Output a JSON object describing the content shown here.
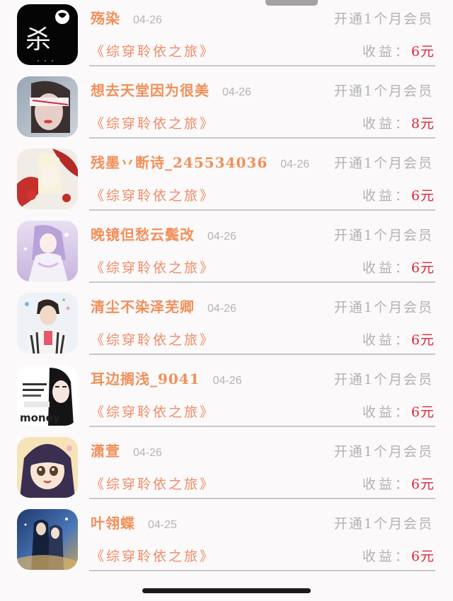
{
  "records": [
    {
      "username": "殇染",
      "date": "04-26",
      "action": "开通1个月会员",
      "book": "《综穿聆依之旅》",
      "income_label": "收益：",
      "income_amount": "6元",
      "avatar": "avatar-dark-calligraphy"
    },
    {
      "username": "想去天堂因为很美",
      "date": "04-26",
      "action": "开通1个月会员",
      "book": "《综穿聆依之旅》",
      "income_label": "收益：",
      "income_amount": "8元",
      "avatar": "avatar-girl-blindfold"
    },
    {
      "username": "残墨丷断诗_245534036",
      "date": "04-26",
      "action": "开通1个月会员",
      "book": "《综穿聆依之旅》",
      "income_label": "收益：",
      "income_amount": "6元",
      "avatar": "avatar-anime-red-flowers"
    },
    {
      "username": "晚镜但愁云鬓改",
      "date": "04-26",
      "action": "开通1个月会员",
      "book": "《综穿聆依之旅》",
      "income_label": "收益：",
      "income_amount": "6元",
      "avatar": "avatar-anime-purple-dress"
    },
    {
      "username": "清尘不染泽芜卿",
      "date": "04-26",
      "action": "开通1个月会员",
      "book": "《综穿聆依之旅》",
      "income_label": "收益：",
      "income_amount": "6元",
      "avatar": "avatar-boy-striped-jacket"
    },
    {
      "username": "耳边搁浅_9041",
      "date": "04-26",
      "action": "开通1个月会员",
      "book": "《综穿聆依之旅》",
      "income_label": "收益：",
      "income_amount": "6元",
      "avatar": "avatar-money-meme"
    },
    {
      "username": "潇萱",
      "date": "04-26",
      "action": "开通1个月会员",
      "book": "《综穿聆依之旅》",
      "income_label": "收益：",
      "income_amount": "6元",
      "avatar": "avatar-anime-girl-smiling"
    },
    {
      "username": "叶翎蝶",
      "date": "04-25",
      "action": "开通1个月会员",
      "book": "《综穿聆依之旅》",
      "income_label": "收益：",
      "income_amount": "6元",
      "avatar": "avatar-anime-blue-couple"
    }
  ],
  "avatar_texts": {
    "money": "money",
    "kanji": "杀"
  },
  "colors": {
    "username": "#f0905a",
    "book": "#ef8c66",
    "muted": "#b3b3b3",
    "amount": "#e0263c",
    "background": "#fbf9fa"
  }
}
